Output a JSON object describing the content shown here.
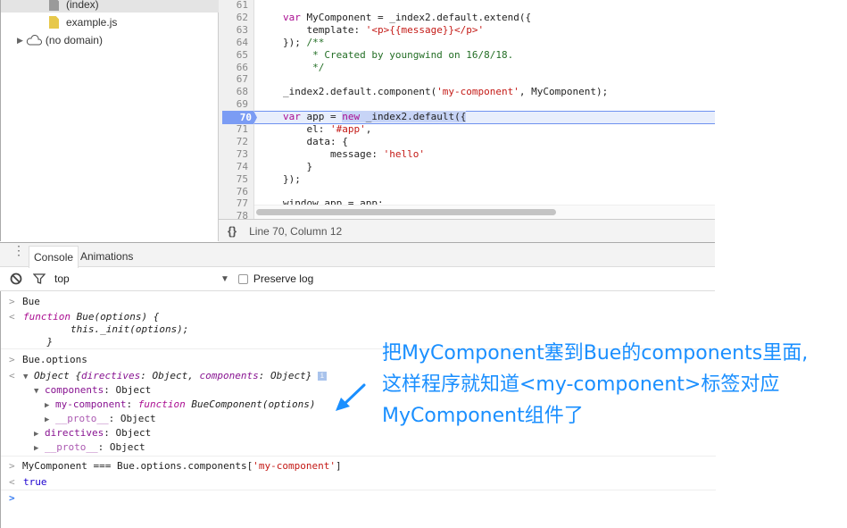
{
  "sidebar": {
    "items": [
      {
        "label": "(index)",
        "icon": "document-icon"
      },
      {
        "label": "example.js",
        "icon": "js-file-icon"
      },
      {
        "label": "(no domain)",
        "icon": "cloud-icon"
      }
    ]
  },
  "editor": {
    "line_numbers": [
      "61",
      "62",
      "63",
      "64",
      "65",
      "66",
      "67",
      "68",
      "69",
      "70",
      "71",
      "72",
      "73",
      "74",
      "75",
      "76",
      "77",
      "78"
    ],
    "current_line": "70",
    "lines": [
      [],
      [
        [
          "kw",
          "var"
        ],
        [
          "",
          "MyComponent = _index2.default.extend({"
        ]
      ],
      [
        [
          "",
          "    template: "
        ],
        [
          "str",
          "'<p>{{message}}</p>'"
        ]
      ],
      [
        [
          "",
          "}); "
        ],
        [
          "cm",
          "/**"
        ]
      ],
      [
        [
          "cm",
          "     * Created by youngwind on 16/8/18."
        ]
      ],
      [
        [
          "cm",
          "     */"
        ]
      ],
      [],
      [
        [
          "",
          "_index2.default.component("
        ],
        [
          "str",
          "'my-component'"
        ],
        [
          "",
          ", MyComponent);"
        ]
      ],
      [],
      [
        [
          "kw",
          "var"
        ],
        [
          "",
          "app = "
        ],
        [
          "kwsel",
          "new"
        ],
        [
          "sel",
          " _index2.default({"
        ]
      ],
      [
        [
          "",
          "    el: "
        ],
        [
          "str",
          "'#app'"
        ],
        [
          "",
          ","
        ]
      ],
      [
        [
          "",
          "    data: {"
        ]
      ],
      [
        [
          "",
          "        message: "
        ],
        [
          "str",
          "'hello'"
        ]
      ],
      [
        [
          "",
          "    }"
        ]
      ],
      [
        [
          "",
          "});"
        ]
      ],
      [],
      [
        [
          "",
          "window.app = app;"
        ]
      ],
      []
    ]
  },
  "status": {
    "icon": "pretty-print-icon",
    "glyph": "{}",
    "position": "Line 70, Column 12"
  },
  "drawer": {
    "tabs": [
      "Console",
      "Animations"
    ],
    "active": "Console"
  },
  "toolbar": {
    "context": "top",
    "preserve_log": "Preserve log",
    "preserve_checked": false
  },
  "console": {
    "in1": "Bue",
    "out1_kw": "function",
    "out1_a": " Bue(options) {",
    "out1_b": "        this._init(options);",
    "out1_c": "    }",
    "in2": "Bue.options",
    "obj_head": "Object {",
    "obj_k1": "directives",
    "obj_v1": ": Object, ",
    "obj_k2": "components",
    "obj_v2": ": Object}",
    "components_k": "components",
    "components_v": ": Object",
    "mycomp_k": "my-component",
    "mycomp_sep": ": ",
    "mycomp_kw": "function",
    "mycomp_v": " BueComponent(options)",
    "proto1_k": "__proto__",
    "proto1_v": ": Object",
    "directives_k": "directives",
    "directives_v": ": Object",
    "proto2_k": "__proto__",
    "proto2_v": ": Object",
    "in3_a": "MyComponent === Bue.options.components[",
    "in3_str": "'my-component'",
    "in3_b": "]",
    "out3": "true"
  },
  "annotation": {
    "lines": [
      "把MyComponent塞到Bue的components里面,",
      "这样程序就知道<my-component>标签对应",
      "MyComponent组件了"
    ],
    "color": "#1a8fff"
  }
}
